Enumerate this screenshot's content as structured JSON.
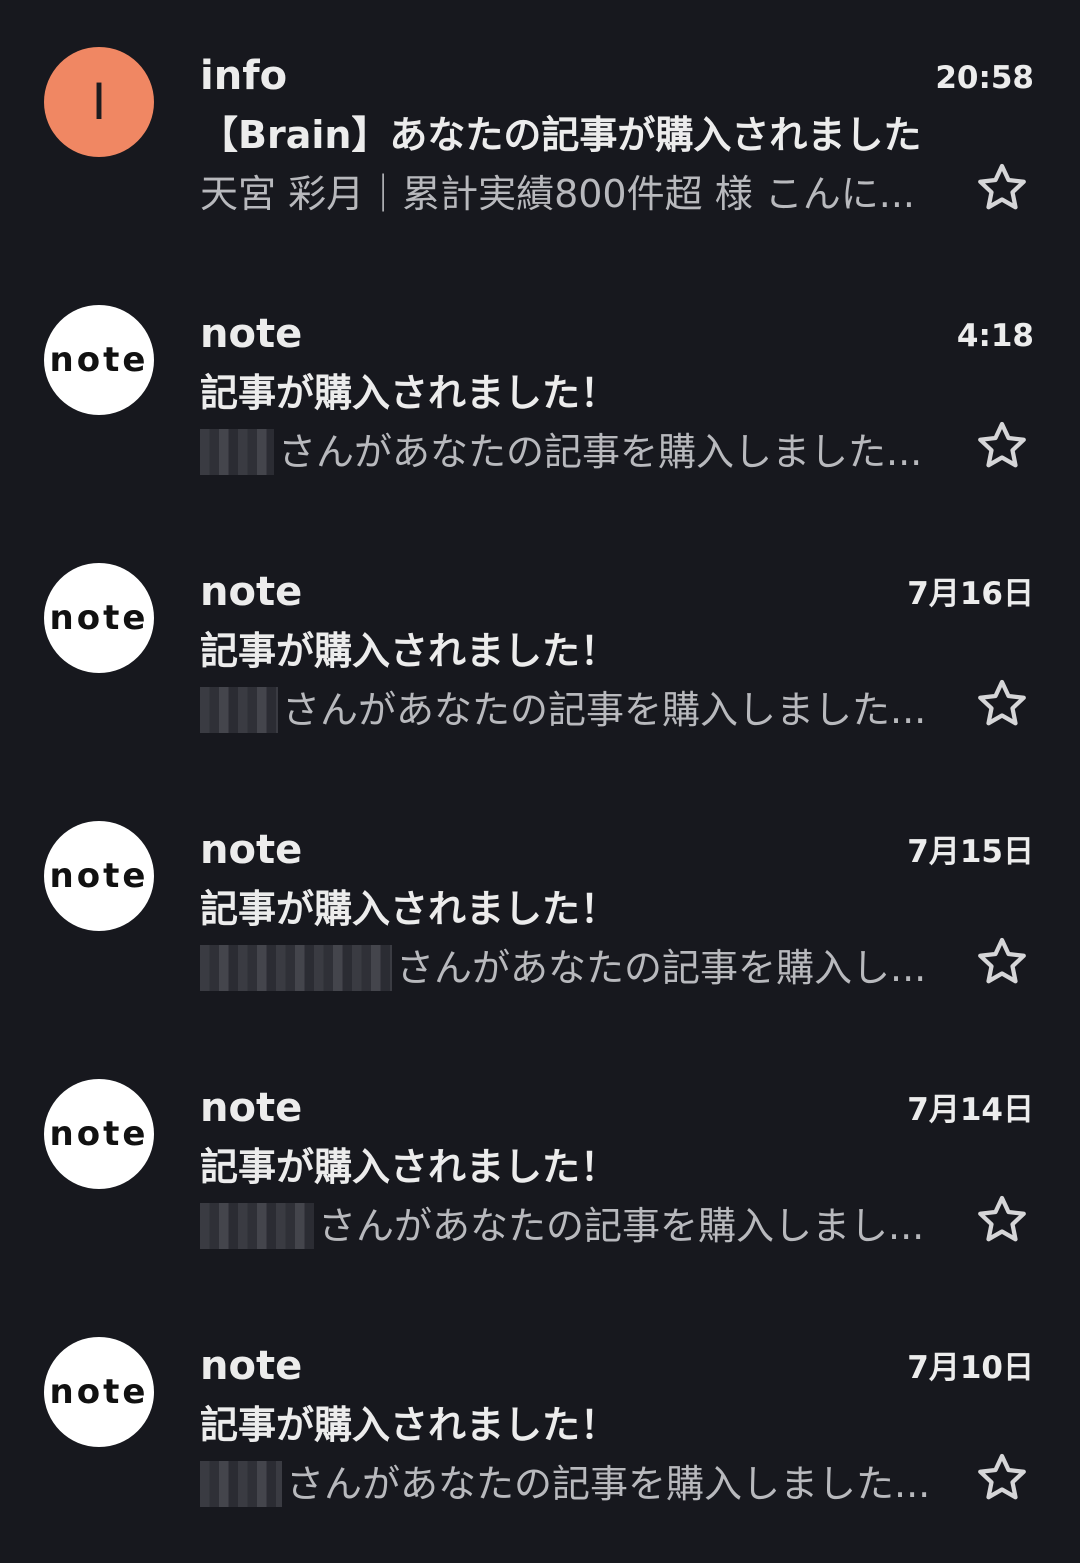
{
  "messages": [
    {
      "avatar_type": "letter",
      "avatar_letter": "I",
      "avatar_color": "#f08763",
      "sender": "info",
      "time": "20:58",
      "subject": "【Brain】あなたの記事が購入されました",
      "snippet": "天宮 彩月｜累計実績800件超 様 こんに...",
      "redacted": false,
      "starred": false
    },
    {
      "avatar_type": "logo",
      "avatar_text": "note",
      "sender": "note",
      "time": "4:18",
      "subject": "記事が購入されました！",
      "snippet": "さんがあなたの記事を購入しました...",
      "redacted": true,
      "starred": false
    },
    {
      "avatar_type": "logo",
      "avatar_text": "note",
      "sender": "note",
      "time": "7月16日",
      "subject": "記事が購入されました！",
      "snippet": "さんがあなたの記事を購入しました...",
      "redacted": true,
      "starred": false
    },
    {
      "avatar_type": "logo",
      "avatar_text": "note",
      "sender": "note",
      "time": "7月15日",
      "subject": "記事が購入されました！",
      "snippet": "さんがあなたの記事を購入し...",
      "redacted": true,
      "starred": false
    },
    {
      "avatar_type": "logo",
      "avatar_text": "note",
      "sender": "note",
      "time": "7月14日",
      "subject": "記事が購入されました！",
      "snippet": "さんがあなたの記事を購入しまし...",
      "redacted": true,
      "starred": false
    },
    {
      "avatar_type": "logo",
      "avatar_text": "note",
      "sender": "note",
      "time": "7月10日",
      "subject": "記事が購入されました！",
      "snippet": "さんがあなたの記事を購入しました...",
      "redacted": true,
      "starred": false
    }
  ],
  "icons": {
    "star": "star-outline-icon"
  },
  "colors": {
    "background": "#17181e",
    "primary_text": "#ececec",
    "secondary_text": "#b8b9bd",
    "letter_avatar": "#f08763"
  }
}
